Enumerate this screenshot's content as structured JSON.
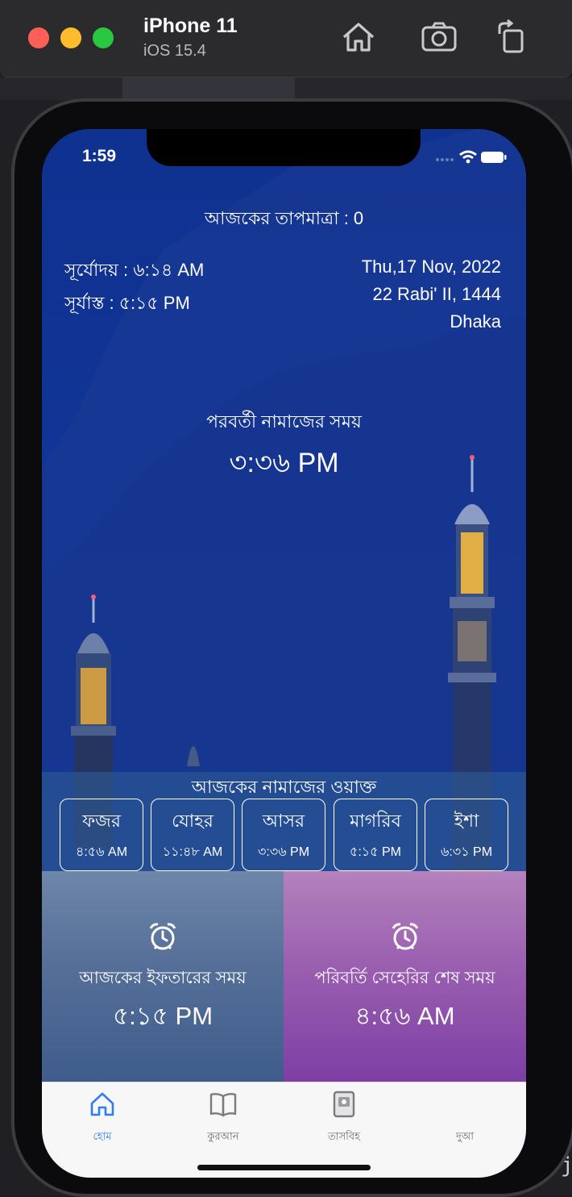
{
  "simulator": {
    "device": "iPhone 11",
    "os": "iOS 15.4",
    "buttons": [
      "home-icon",
      "screenshot-icon",
      "rotate-icon"
    ]
  },
  "status_bar": {
    "time": "1:59"
  },
  "header": {
    "temperature": "আজকের তাপমাত্রা :  0",
    "sunrise": "সূর্যোদয় :  ৬:১৪ AM",
    "sunset": "সূর্যাস্ত   :  ৫:১৫ PM",
    "date": "Thu,17 Nov, 2022",
    "hijri_date": "22 Rabi' II, 1444",
    "city": "Dhaka"
  },
  "next_prayer": {
    "label": "পরবর্তী নামাজের সময়",
    "time": "৩:৩৬ PM"
  },
  "prayer_times": {
    "title": "আজকের নামাজের ওয়াক্ত",
    "items": [
      {
        "name": "ফজর",
        "time": "৪:৫৬ AM"
      },
      {
        "name": "যোহর",
        "time": "১১:৪৮ AM"
      },
      {
        "name": "আসর",
        "time": "৩:৩৬ PM"
      },
      {
        "name": "মাগরিব",
        "time": "৫:১৫ PM"
      },
      {
        "name": "ইশা",
        "time": "৬:৩১ PM"
      }
    ]
  },
  "iftar": {
    "icon": "alarm-clock-icon",
    "label": "আজকের ইফতারের সময়",
    "time": "৫:১৫ PM"
  },
  "sehri": {
    "icon": "alarm-clock-icon",
    "label": "পরিবর্তি সেহেরির শেষ সময়",
    "time": "৪:৫৬ AM"
  },
  "tab_bar": {
    "active_color": "#2f7df6",
    "tabs": [
      {
        "label": "হোম",
        "icon": "home-icon",
        "active": true
      },
      {
        "label": "কুরআন",
        "icon": "book-icon",
        "active": false
      },
      {
        "label": "তাসবিহ",
        "icon": "tasbih-icon",
        "active": false
      },
      {
        "label": "দুআ",
        "icon": "dua-icon",
        "active": false
      }
    ]
  }
}
